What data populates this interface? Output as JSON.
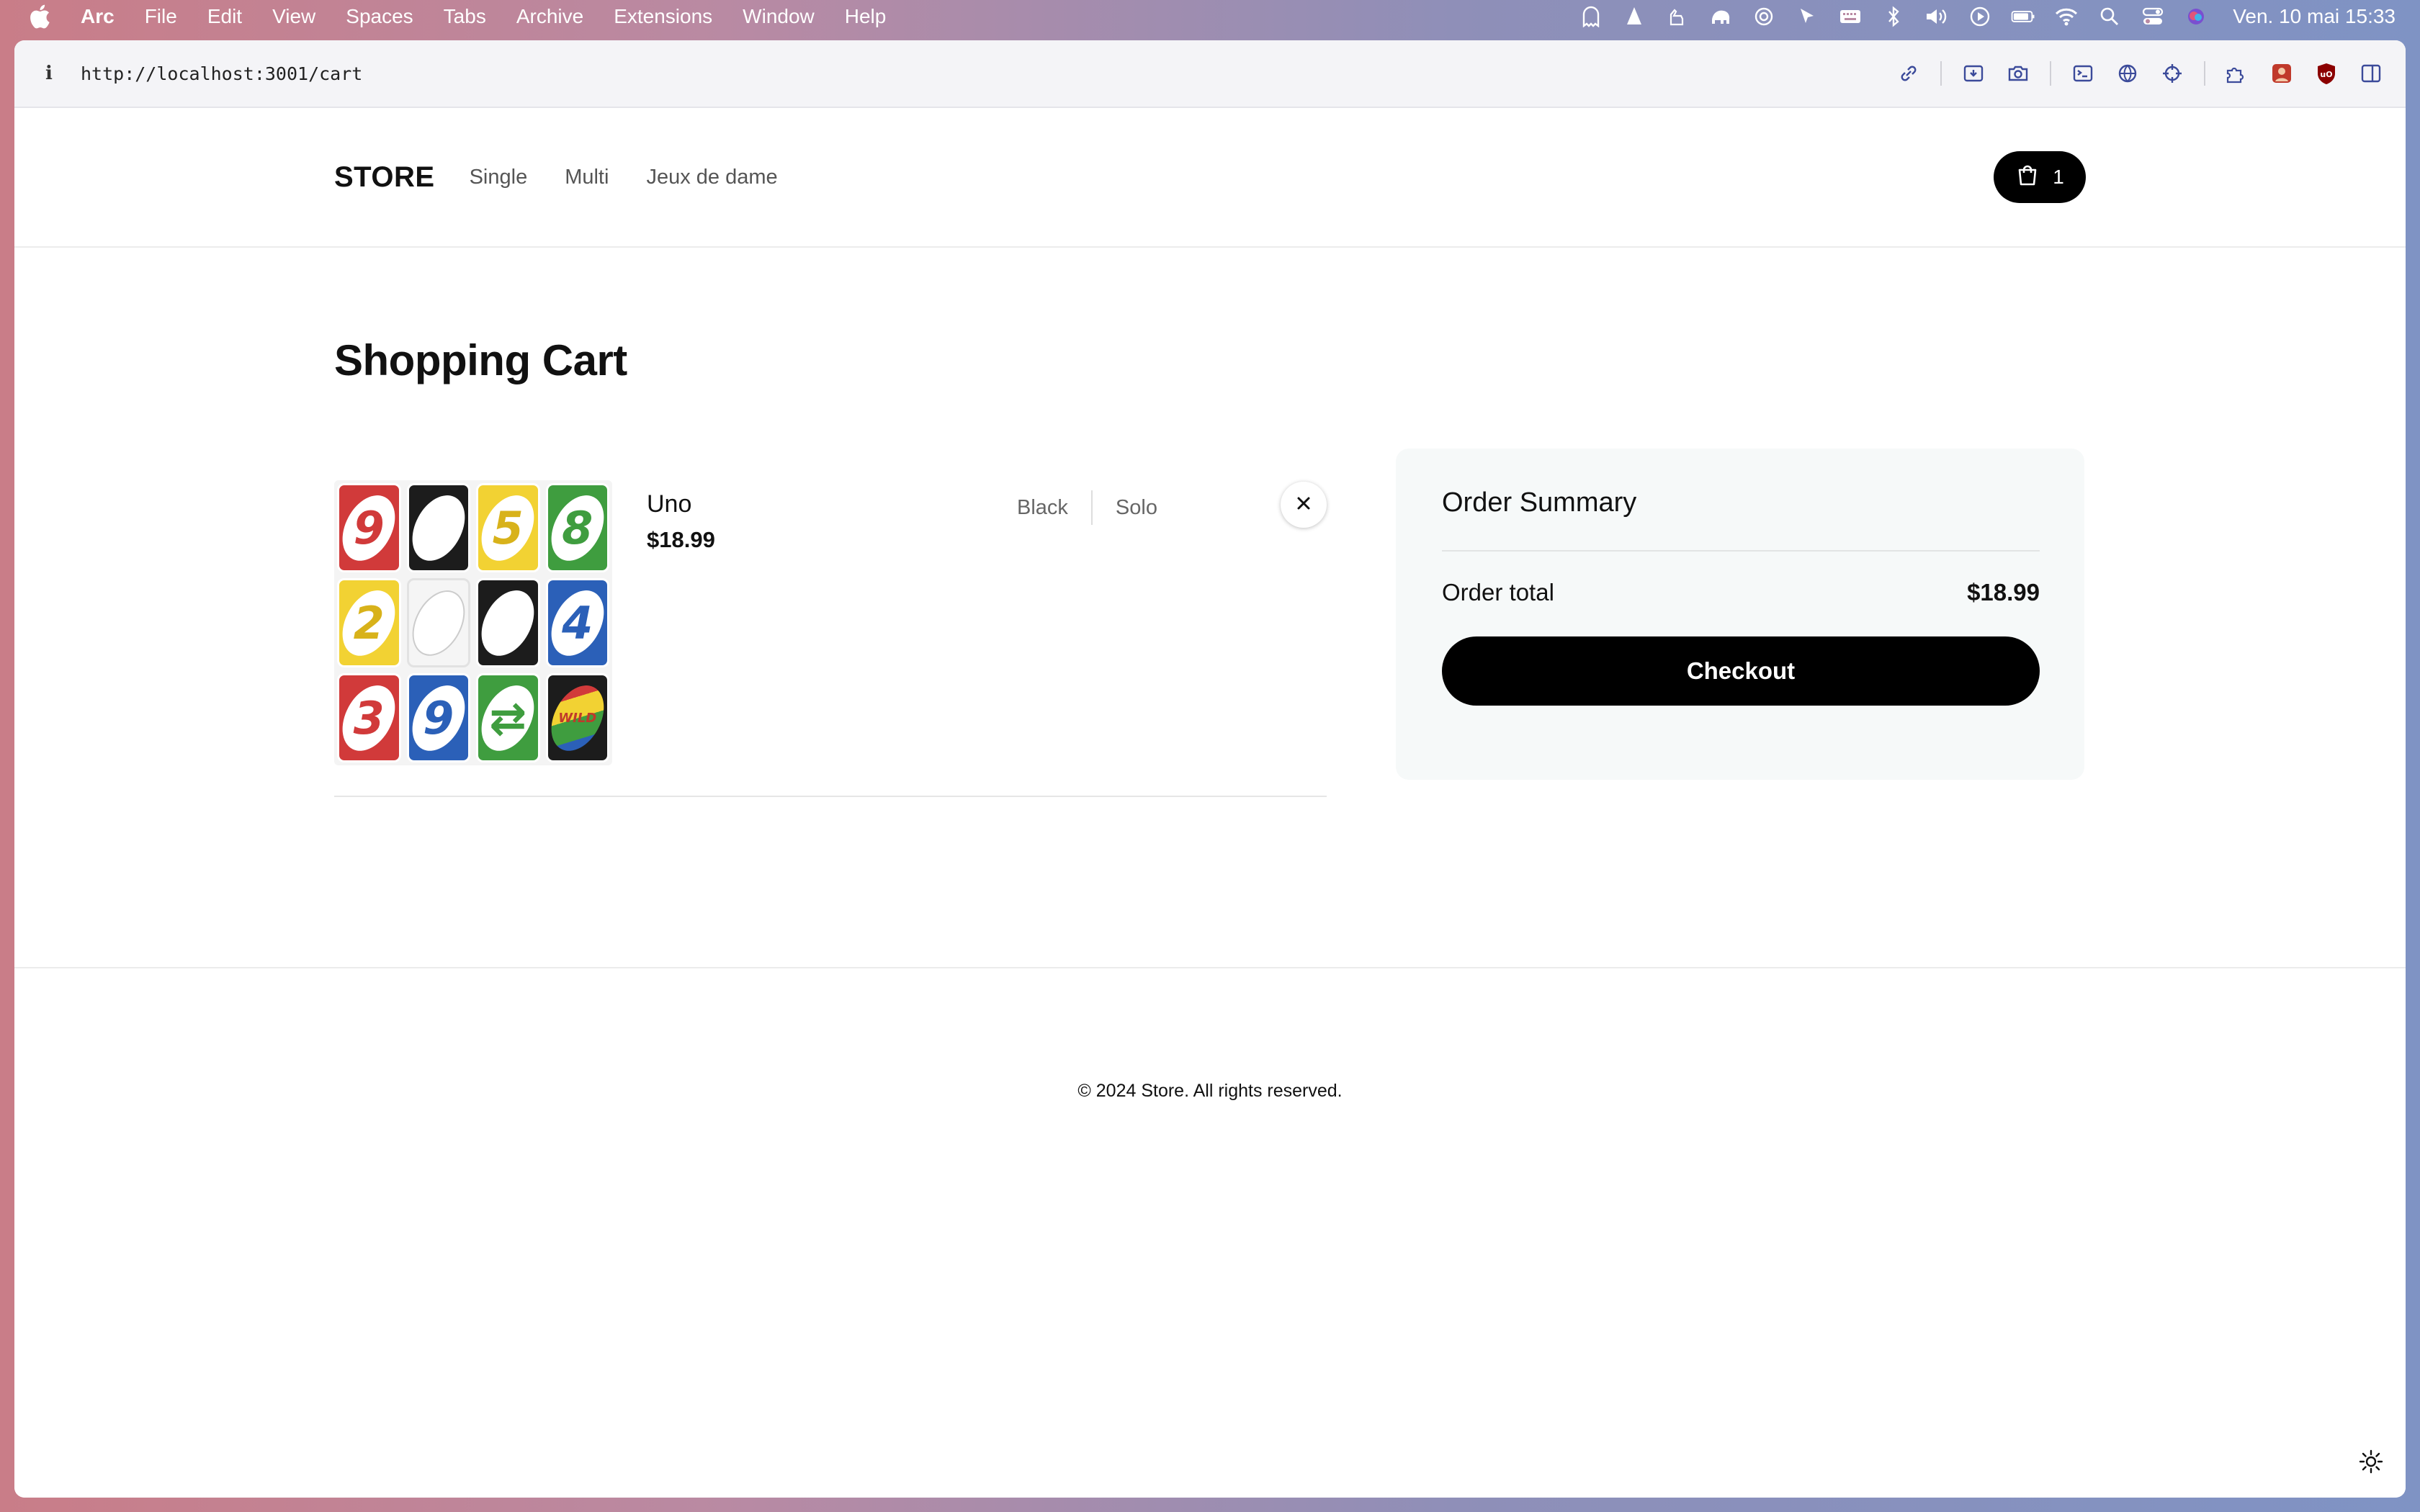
{
  "menubar": {
    "app": "Arc",
    "menus": [
      "File",
      "Edit",
      "View",
      "Spaces",
      "Tabs",
      "Archive",
      "Extensions",
      "Window",
      "Help"
    ],
    "clock": "Ven. 10 mai  15:33"
  },
  "browser": {
    "url": "http://localhost:3001/cart"
  },
  "nav": {
    "brand": "STORE",
    "links": [
      "Single",
      "Multi",
      "Jeux de dame"
    ],
    "cart_count": "1"
  },
  "main": {
    "title": "Shopping Cart",
    "item": {
      "name": "Uno",
      "price": "$18.99",
      "color": "Black",
      "mode": "Solo",
      "thumbnail": {
        "cards": [
          {
            "color": "red",
            "label": "9"
          },
          {
            "color": "black",
            "label": ""
          },
          {
            "color": "yellow",
            "label": "5"
          },
          {
            "color": "green",
            "label": "8"
          },
          {
            "color": "yellow",
            "label": "2"
          },
          {
            "color": "white",
            "label": ""
          },
          {
            "color": "black",
            "label": ""
          },
          {
            "color": "blue",
            "label": "4"
          },
          {
            "color": "red",
            "label": "3"
          },
          {
            "color": "blue",
            "label": "9"
          },
          {
            "color": "green",
            "label": "⇄"
          },
          {
            "color": "black",
            "label": "WILD"
          }
        ]
      }
    }
  },
  "summary": {
    "title": "Order Summary",
    "total_label": "Order total",
    "total_value": "$18.99",
    "checkout_label": "Checkout"
  },
  "footer": {
    "text": "© 2024 Store. All rights reserved."
  },
  "icons": {
    "tray": [
      "ghost-icon",
      "vlc-icon",
      "hands-icon",
      "elephant-icon",
      "chatgpt-icon",
      "pointer-icon",
      "keyboard-icon",
      "bluetooth-icon",
      "volume-icon",
      "play-icon",
      "battery-icon",
      "wifi-icon",
      "search-icon",
      "control-center-icon",
      "siri-icon"
    ]
  }
}
